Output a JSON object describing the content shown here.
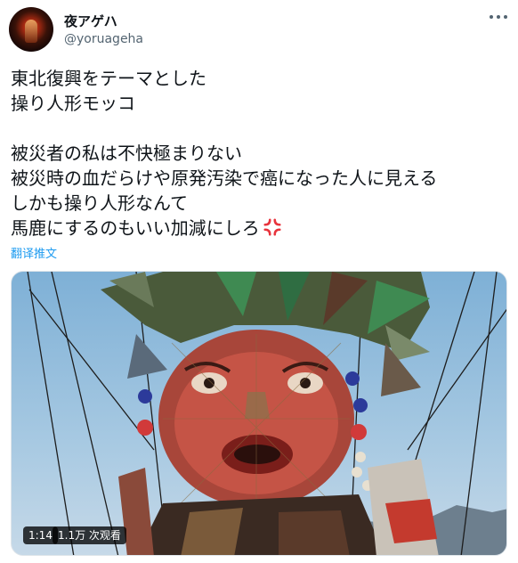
{
  "author": {
    "display_name": "夜アゲハ",
    "handle": "@yoruageha",
    "avatar_icon": "avatar-image"
  },
  "tweet": {
    "lines_block1": [
      "東北復興をテーマとした",
      "操り人形モッコ"
    ],
    "lines_block2": [
      "被災者の私は不快極まりない",
      "被災時の血だらけや原発汚染で癌になった人に見える",
      "しかも操り人形なんて",
      "馬鹿にするのもいい加減にしろ"
    ],
    "emoji_icon": "anger-symbol-icon",
    "translate_label": "翻译推文"
  },
  "video": {
    "duration": "1:14",
    "views": "1.1万 次观看"
  },
  "colors": {
    "link": "#1d9bf0",
    "secondary_text": "#536471",
    "anger": "#e8333c"
  }
}
